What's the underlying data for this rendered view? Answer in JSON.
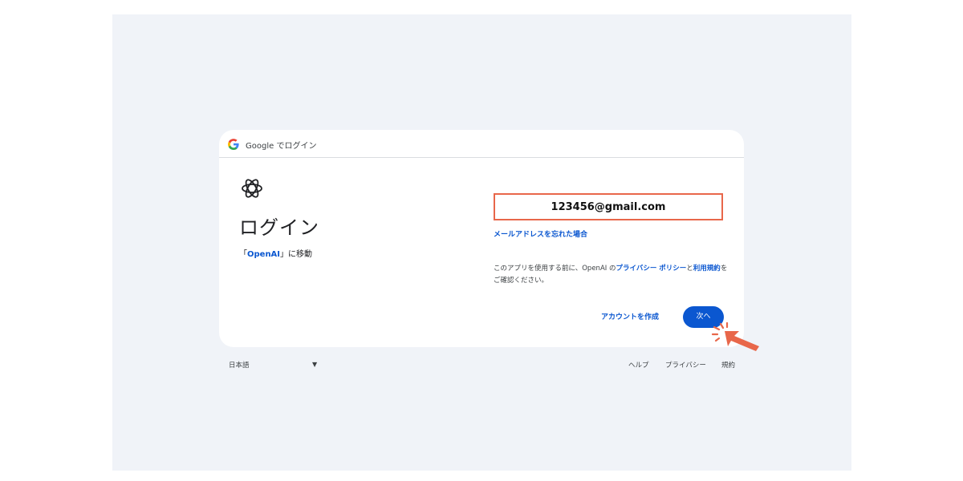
{
  "header": {
    "title": "Google でログイン"
  },
  "page": {
    "title": "ログイン",
    "subtitle_prefix": "「",
    "subtitle_link": "OpenAI",
    "subtitle_suffix": "」に移動"
  },
  "email": {
    "value": "123456@gmail.com"
  },
  "forgot_email": "メールアドレスを忘れた場合",
  "policy": {
    "text1": "このアプリを使用する前に、OpenAI の",
    "link1": "プライバシー ポリシー",
    "text2": "と",
    "link2": "利用規約",
    "text3": "をご確認ください。"
  },
  "actions": {
    "create_account": "アカウントを作成",
    "next": "次へ"
  },
  "footer": {
    "language": "日本語",
    "help": "ヘルプ",
    "privacy": "プライバシー",
    "terms": "規約"
  },
  "colors": {
    "accent": "#0b57d0",
    "highlight": "#e8674a",
    "background": "#f0f3f8"
  }
}
